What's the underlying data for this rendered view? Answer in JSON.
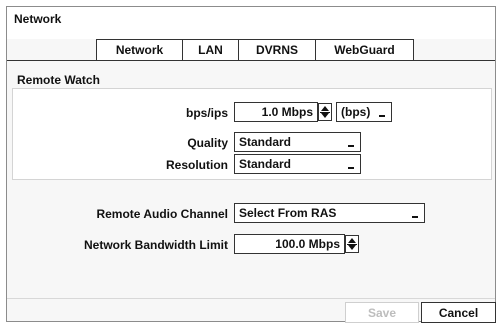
{
  "window": {
    "title": "Network"
  },
  "tabs": [
    {
      "label": "Network",
      "active": true
    },
    {
      "label": "LAN",
      "active": false
    },
    {
      "label": "DVRNS",
      "active": false
    },
    {
      "label": "WebGuard",
      "active": false
    }
  ],
  "remote_watch": {
    "section_label": "Remote Watch",
    "bps_label": "bps/ips",
    "bps_value": "1.0 Mbps",
    "bps_unit": "(bps)",
    "quality_label": "Quality",
    "quality_value": "Standard",
    "resolution_label": "Resolution",
    "resolution_value": "Standard"
  },
  "audio": {
    "label": "Remote Audio Channel",
    "value": "Select From RAS"
  },
  "bandwidth": {
    "label": "Network Bandwidth Limit",
    "value": "100.0 Mbps"
  },
  "buttons": {
    "save_label": "Save",
    "cancel_label": "Cancel"
  }
}
